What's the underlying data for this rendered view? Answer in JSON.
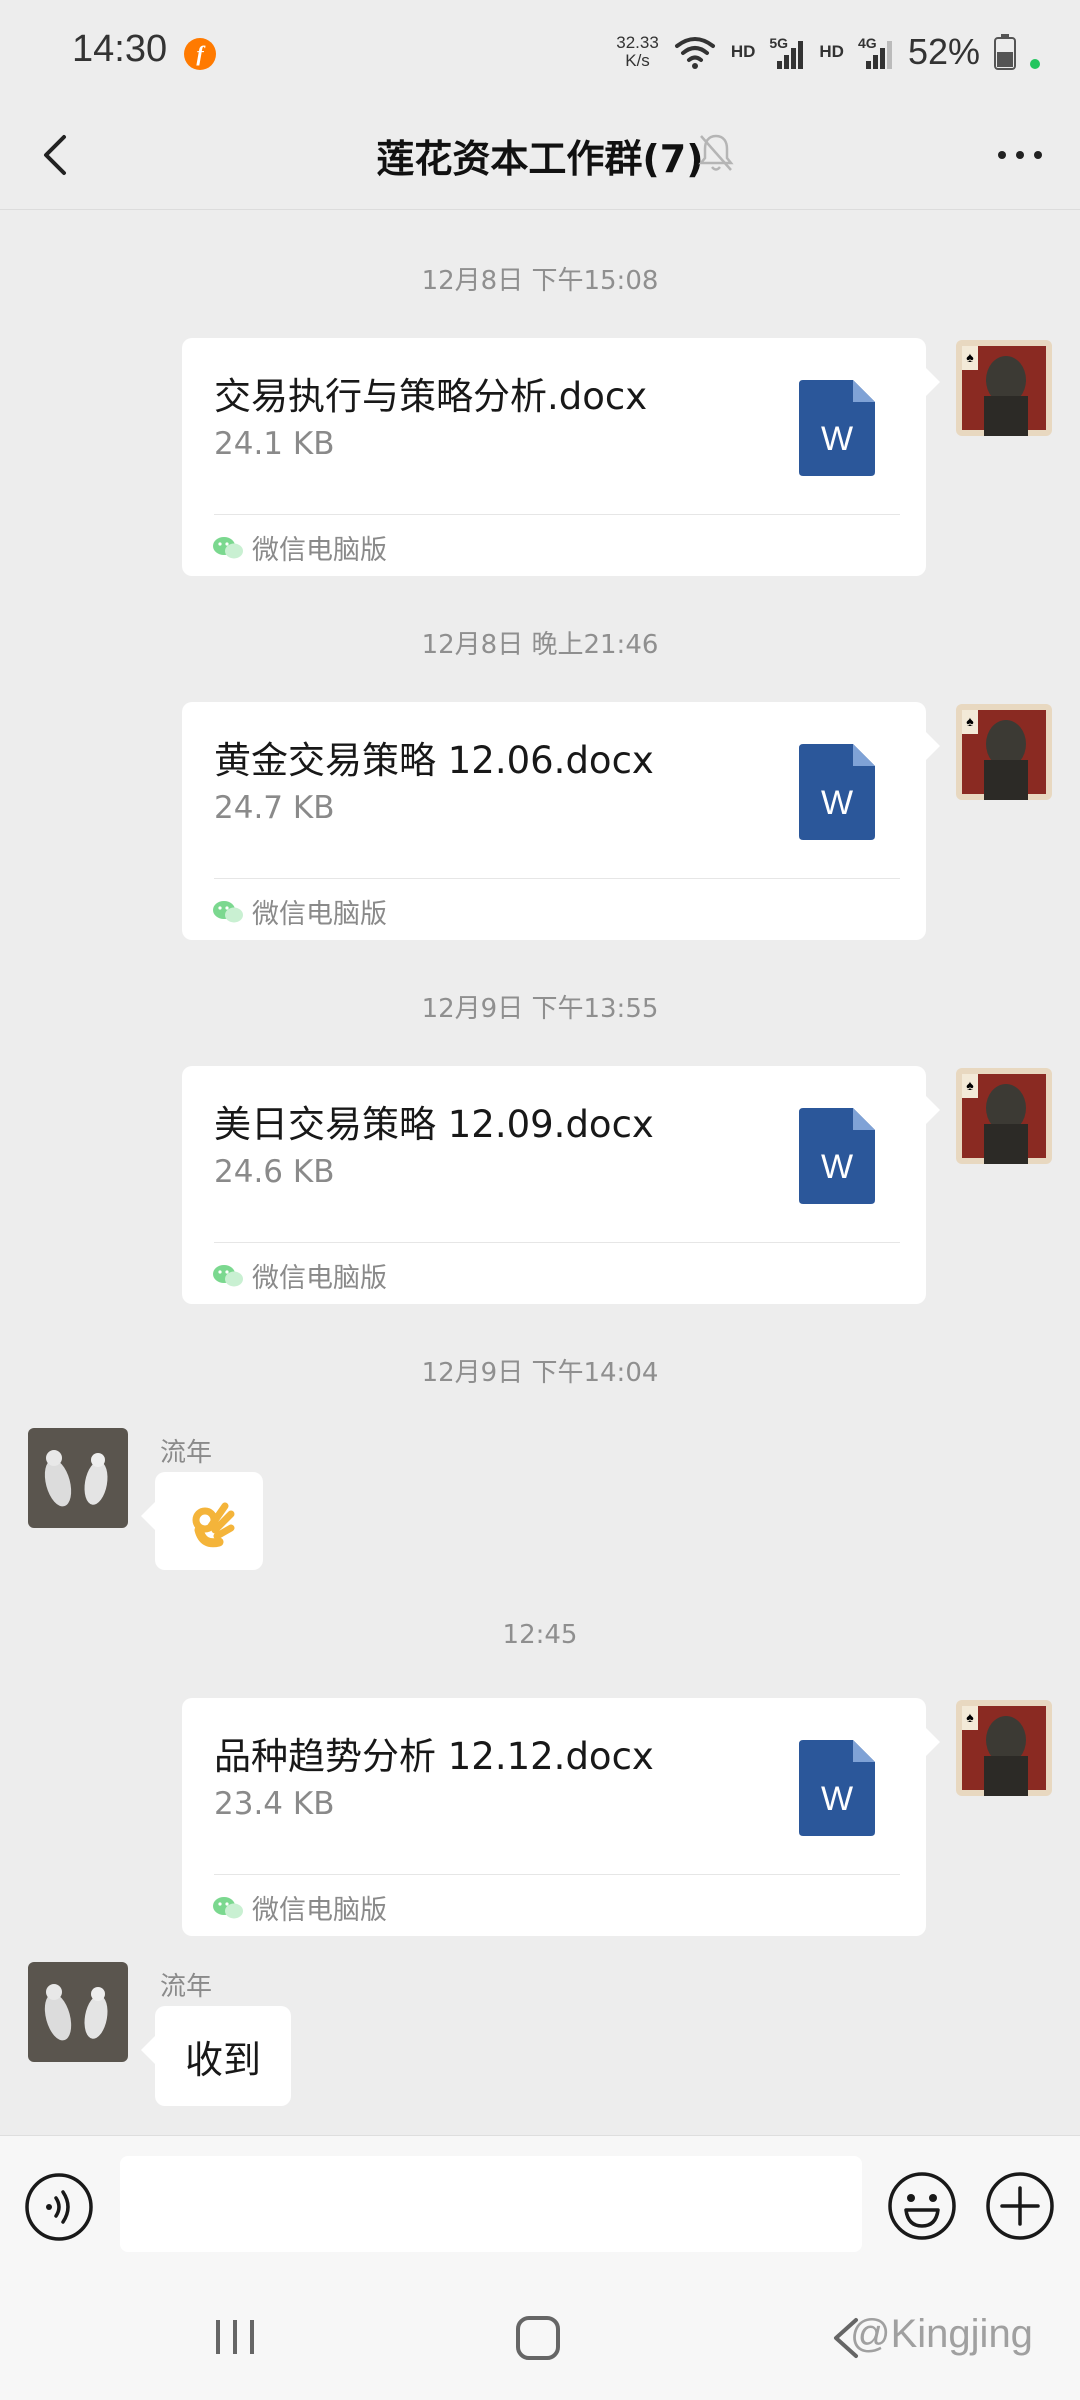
{
  "status_bar": {
    "time": "14:30",
    "app_icon_letter": "f",
    "net_speed_value": "32.33",
    "net_speed_unit": "K/s",
    "hd1": "HD",
    "gen1": "5G",
    "hd2": "HD",
    "gen2": "4G",
    "battery": "52%"
  },
  "header": {
    "title": "莲花资本工作群(7)"
  },
  "messages": [
    {
      "timestamp": "12月8日 下午15:08",
      "file_name": "交易执行与策略分析.docx",
      "file_size": "24.1 KB",
      "source": "微信电脑版",
      "icon_letter": "W"
    },
    {
      "timestamp": "12月8日 晚上21:46",
      "file_name": "黄金交易策略 12.06.docx",
      "file_size": "24.7 KB",
      "source": "微信电脑版",
      "icon_letter": "W"
    },
    {
      "timestamp": "12月9日 下午13:55",
      "file_name": "美日交易策略 12.09.docx",
      "file_size": "24.6 KB",
      "source": "微信电脑版",
      "icon_letter": "W"
    },
    {
      "timestamp": "12月9日 下午14:04",
      "sender": "流年",
      "emoji": "ok-hand"
    },
    {
      "timestamp": "12:45",
      "file_name": "品种趋势分析 12.12.docx",
      "file_size": "23.4 KB",
      "source": "微信电脑版",
      "icon_letter": "W"
    },
    {
      "sender": "流年",
      "text": "收到"
    }
  ],
  "watermark": "@Kingjing",
  "colors": {
    "background": "#ededed",
    "word_blue": "#2b579a",
    "wechat_green": "#07c160"
  }
}
